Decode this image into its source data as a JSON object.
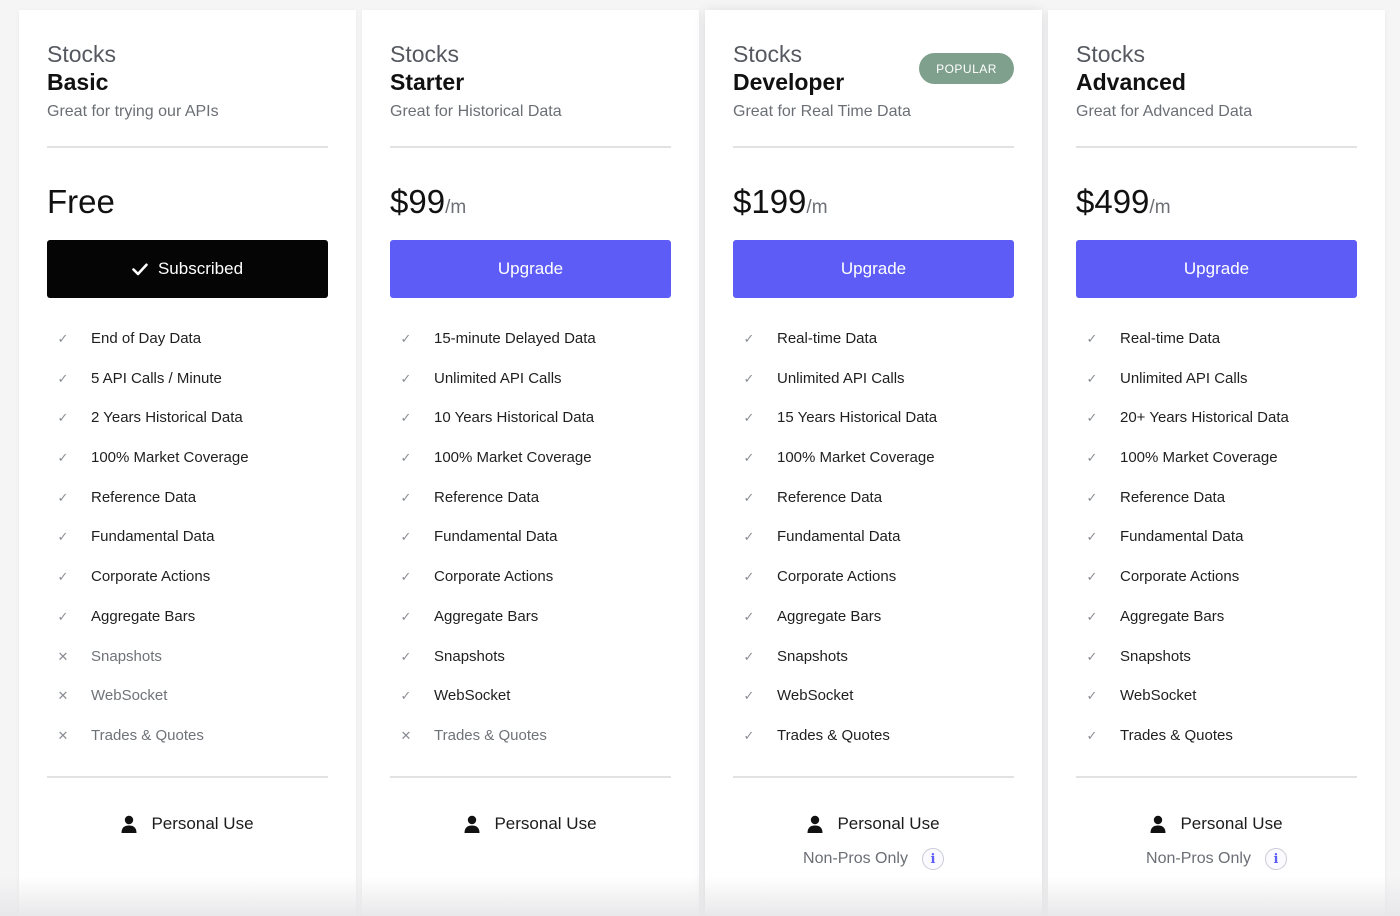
{
  "plans": [
    {
      "product": "Stocks",
      "tier": "Basic",
      "tagline": "Great for trying our APIs",
      "price": "Free",
      "period": "",
      "badge": "",
      "button": {
        "label": "Subscribed",
        "style": "subscribed",
        "icon": "check-icon"
      },
      "features": [
        {
          "label": "End of Day Data",
          "included": true
        },
        {
          "label": "5 API Calls / Minute",
          "included": true
        },
        {
          "label": "2 Years Historical Data",
          "included": true
        },
        {
          "label": "100% Market Coverage",
          "included": true
        },
        {
          "label": "Reference Data",
          "included": true
        },
        {
          "label": "Fundamental Data",
          "included": true
        },
        {
          "label": "Corporate Actions",
          "included": true
        },
        {
          "label": "Aggregate Bars",
          "included": true
        },
        {
          "label": "Snapshots",
          "included": false
        },
        {
          "label": "WebSocket",
          "included": false
        },
        {
          "label": "Trades & Quotes",
          "included": false
        }
      ],
      "use": "Personal Use",
      "restriction": ""
    },
    {
      "product": "Stocks",
      "tier": "Starter",
      "tagline": "Great for Historical Data",
      "price": "$99",
      "period": "/m",
      "badge": "",
      "button": {
        "label": "Upgrade",
        "style": "upgrade",
        "icon": ""
      },
      "features": [
        {
          "label": "15-minute Delayed Data",
          "included": true
        },
        {
          "label": "Unlimited API Calls",
          "included": true
        },
        {
          "label": "10 Years Historical Data",
          "included": true
        },
        {
          "label": "100% Market Coverage",
          "included": true
        },
        {
          "label": "Reference Data",
          "included": true
        },
        {
          "label": "Fundamental Data",
          "included": true
        },
        {
          "label": "Corporate Actions",
          "included": true
        },
        {
          "label": "Aggregate Bars",
          "included": true
        },
        {
          "label": "Snapshots",
          "included": true
        },
        {
          "label": "WebSocket",
          "included": true
        },
        {
          "label": "Trades & Quotes",
          "included": false
        }
      ],
      "use": "Personal Use",
      "restriction": ""
    },
    {
      "product": "Stocks",
      "tier": "Developer",
      "tagline": "Great for Real Time Data",
      "price": "$199",
      "period": "/m",
      "badge": "POPULAR",
      "button": {
        "label": "Upgrade",
        "style": "upgrade",
        "icon": ""
      },
      "features": [
        {
          "label": "Real-time Data",
          "included": true
        },
        {
          "label": "Unlimited API Calls",
          "included": true
        },
        {
          "label": "15 Years Historical Data",
          "included": true
        },
        {
          "label": "100% Market Coverage",
          "included": true
        },
        {
          "label": "Reference Data",
          "included": true
        },
        {
          "label": "Fundamental Data",
          "included": true
        },
        {
          "label": "Corporate Actions",
          "included": true
        },
        {
          "label": "Aggregate Bars",
          "included": true
        },
        {
          "label": "Snapshots",
          "included": true
        },
        {
          "label": "WebSocket",
          "included": true
        },
        {
          "label": "Trades & Quotes",
          "included": true
        }
      ],
      "use": "Personal Use",
      "restriction": "Non-Pros Only"
    },
    {
      "product": "Stocks",
      "tier": "Advanced",
      "tagline": "Great for Advanced Data",
      "price": "$499",
      "period": "/m",
      "badge": "",
      "button": {
        "label": "Upgrade",
        "style": "upgrade",
        "icon": ""
      },
      "features": [
        {
          "label": "Real-time Data",
          "included": true
        },
        {
          "label": "Unlimited API Calls",
          "included": true
        },
        {
          "label": "20+ Years Historical Data",
          "included": true
        },
        {
          "label": "100% Market Coverage",
          "included": true
        },
        {
          "label": "Reference Data",
          "included": true
        },
        {
          "label": "Fundamental Data",
          "included": true
        },
        {
          "label": "Corporate Actions",
          "included": true
        },
        {
          "label": "Aggregate Bars",
          "included": true
        },
        {
          "label": "Snapshots",
          "included": true
        },
        {
          "label": "WebSocket",
          "included": true
        },
        {
          "label": "Trades & Quotes",
          "included": true
        }
      ],
      "use": "Personal Use",
      "restriction": "Non-Pros Only"
    }
  ],
  "icons": {
    "included": "check-icon",
    "excluded": "x-icon",
    "use": "person-icon",
    "info": "info-icon"
  },
  "colors": {
    "upgrade_button": "#5d5cf6",
    "subscribed_button": "#050505",
    "popular_badge": "#7fa08d"
  }
}
